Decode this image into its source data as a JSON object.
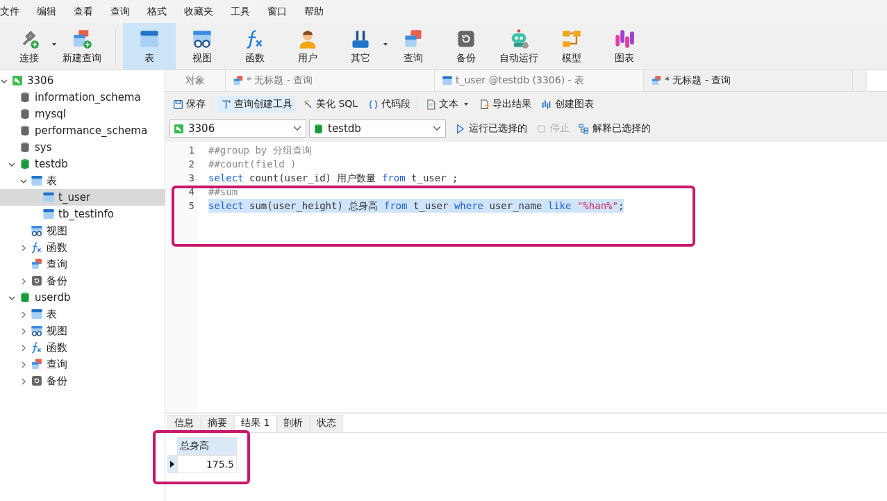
{
  "menu": [
    "文件",
    "编辑",
    "查看",
    "查询",
    "格式",
    "收藏夹",
    "工具",
    "窗口",
    "帮助"
  ],
  "toolbar": [
    {
      "label": "连接",
      "selected": false,
      "dropdown": true
    },
    {
      "label": "新建查询",
      "selected": false,
      "dropdown": false
    },
    {
      "label": "表",
      "selected": true,
      "dropdown": false
    },
    {
      "label": "视图",
      "selected": false,
      "dropdown": false
    },
    {
      "label": "函数",
      "selected": false,
      "dropdown": false
    },
    {
      "label": "用户",
      "selected": false,
      "dropdown": false
    },
    {
      "label": "其它",
      "selected": false,
      "dropdown": true
    },
    {
      "label": "查询",
      "selected": false,
      "dropdown": false
    },
    {
      "label": "备份",
      "selected": false,
      "dropdown": false
    },
    {
      "label": "自动运行",
      "selected": false,
      "dropdown": false
    },
    {
      "label": "模型",
      "selected": false,
      "dropdown": false
    },
    {
      "label": "图表",
      "selected": false,
      "dropdown": false
    }
  ],
  "tree": [
    {
      "label": "3306",
      "kind": "connection",
      "expanded": true,
      "selected": false,
      "children": [
        {
          "label": "information_schema",
          "kind": "closed-database",
          "selected": false
        },
        {
          "label": "mysql",
          "kind": "closed-database",
          "selected": false
        },
        {
          "label": "performance_schema",
          "kind": "closed-database",
          "selected": false
        },
        {
          "label": "sys",
          "kind": "closed-database",
          "selected": false
        },
        {
          "label": "testdb",
          "kind": "database",
          "expanded": true,
          "selected": false,
          "children": [
            {
              "label": "表",
              "kind": "table",
              "expanded": true,
              "selected": false,
              "children": [
                {
                  "label": "t_user",
                  "kind": "table",
                  "selected": true
                },
                {
                  "label": "tb_testinfo",
                  "kind": "table",
                  "selected": false
                }
              ]
            },
            {
              "label": "视图",
              "kind": "view",
              "selected": false
            },
            {
              "label": "函数",
              "kind": "function",
              "expanded": false,
              "selected": false
            },
            {
              "label": "查询",
              "kind": "query",
              "selected": false
            },
            {
              "label": "备份",
              "kind": "backup",
              "expanded": false,
              "selected": false
            }
          ]
        },
        {
          "label": "userdb",
          "kind": "database",
          "expanded": true,
          "selected": false,
          "children": [
            {
              "label": "表",
              "kind": "table",
              "expanded": false,
              "selected": false
            },
            {
              "label": "视图",
              "kind": "view",
              "expanded": false,
              "selected": false
            },
            {
              "label": "函数",
              "kind": "function",
              "expanded": false,
              "selected": false
            },
            {
              "label": "查询",
              "kind": "query",
              "expanded": false,
              "selected": false
            },
            {
              "label": "备份",
              "kind": "backup",
              "expanded": false,
              "selected": false
            }
          ]
        }
      ]
    }
  ],
  "tabs": [
    {
      "label": "对象",
      "kind": "object",
      "selected": false
    },
    {
      "label": "* 无标题 - 查询",
      "kind": "query",
      "selected": false
    },
    {
      "label": "t_user @testdb (3306) - 表",
      "kind": "table",
      "selected": false
    },
    {
      "label": "* 无标题 - 查询",
      "kind": "query",
      "selected": true
    }
  ],
  "query_toolbar": [
    {
      "label": "保存",
      "selected": false,
      "dropdown": false
    },
    {
      "label": "查询创建工具",
      "selected": true,
      "dropdown": false
    },
    {
      "label": "美化 SQL",
      "selected": false,
      "dropdown": false
    },
    {
      "label": "代码段",
      "selected": false,
      "dropdown": false
    },
    {
      "label": "文本",
      "selected": false,
      "dropdown": true
    },
    {
      "label": "导出结果",
      "selected": false,
      "dropdown": false
    },
    {
      "label": "创建图表",
      "selected": false,
      "dropdown": false
    }
  ],
  "connection_select": {
    "value": "3306"
  },
  "database_select": {
    "value": "testdb"
  },
  "run_actions": [
    {
      "label": "运行已选择的",
      "disabled": false
    },
    {
      "label": "停止",
      "disabled": true
    },
    {
      "label": "解释已选择的",
      "disabled": false
    }
  ],
  "editor": {
    "highlighted": true,
    "lines": [
      {
        "number": "1",
        "selected": false,
        "tokens": [
          {
            "kind": "comment",
            "text": "##group by 分组查询"
          }
        ]
      },
      {
        "number": "2",
        "selected": false,
        "tokens": [
          {
            "kind": "comment",
            "text": "##count(field )"
          }
        ]
      },
      {
        "number": "3",
        "selected": false,
        "tokens": [
          {
            "kind": "keyword",
            "text": "select"
          },
          {
            "kind": "plain",
            "text": " count(user_id) 用户数量 "
          },
          {
            "kind": "keyword",
            "text": "from"
          },
          {
            "kind": "plain",
            "text": " t_user ;"
          }
        ]
      },
      {
        "number": "4",
        "selected": false,
        "tokens": [
          {
            "kind": "comment",
            "text": "##sum"
          }
        ]
      },
      {
        "number": "5",
        "selected": true,
        "tokens": [
          {
            "kind": "keyword",
            "text": "select"
          },
          {
            "kind": "plain",
            "text": " sum(user_height) 总身高 "
          },
          {
            "kind": "keyword",
            "text": "from"
          },
          {
            "kind": "plain",
            "text": " t_user "
          },
          {
            "kind": "keyword",
            "text": "where"
          },
          {
            "kind": "plain",
            "text": " user_name "
          },
          {
            "kind": "keyword",
            "text": "like"
          },
          {
            "kind": "string",
            "text": " \"%han%\""
          },
          {
            "kind": "plain",
            "text": ";"
          }
        ]
      }
    ]
  },
  "result_tabs": [
    {
      "label": "信息",
      "selected": false
    },
    {
      "label": "摘要",
      "selected": false
    },
    {
      "label": "结果 1",
      "selected": true
    },
    {
      "label": "剖析",
      "selected": false
    },
    {
      "label": "状态",
      "selected": false
    }
  ],
  "result": {
    "highlighted": true,
    "columns": [
      "总身高"
    ],
    "rows": [
      {
        "cells": [
          "175.5"
        ],
        "current": true
      }
    ]
  }
}
